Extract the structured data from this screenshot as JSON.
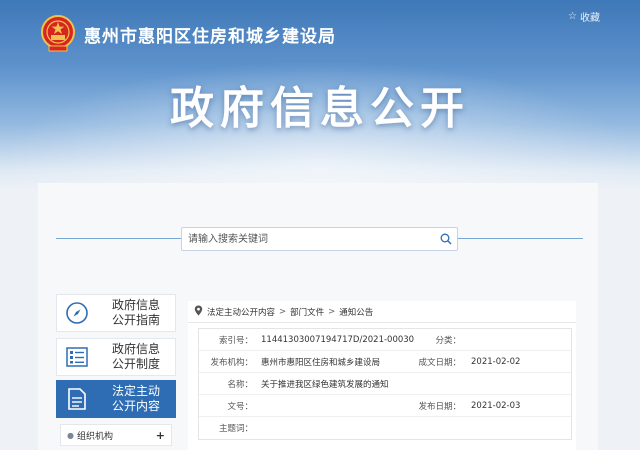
{
  "header": {
    "org_name": "惠州市惠阳区住房和城乡建设局",
    "collect_label": "收藏",
    "main_title": "政府信息公开"
  },
  "search": {
    "placeholder": "请输入搜索关键词"
  },
  "sidebar": {
    "items": [
      {
        "line1": "政府信息",
        "line2": "公开指南",
        "icon": "compass-icon"
      },
      {
        "line1": "政府信息",
        "line2": "公开制度",
        "icon": "list-document-icon"
      },
      {
        "line1": "法定主动",
        "line2": "公开内容",
        "icon": "document-icon"
      }
    ],
    "subitem": {
      "label": "组织机构",
      "toggle": "+"
    }
  },
  "breadcrumb": [
    "法定主动公开内容",
    "部门文件",
    "通知公告"
  ],
  "info": {
    "index_no_label": "索引号：",
    "index_no": "11441303007194717D/2021-00030",
    "category_label": "分类：",
    "category": "",
    "publisher_label": "发布机构：",
    "publisher": "惠州市惠阳区住房和城乡建设局",
    "created_label": "成文日期：",
    "created": "2021-02-02",
    "name_label": "名称：",
    "name": "关于推进我区绿色建筑发展的通知",
    "doc_no_label": "文号：",
    "doc_no": "",
    "published_label": "发布日期：",
    "published": "2021-02-03",
    "subject_label": "主题词：",
    "subject": ""
  },
  "colors": {
    "accent": "#2e6db4",
    "banner_top": "#3f78b8"
  }
}
